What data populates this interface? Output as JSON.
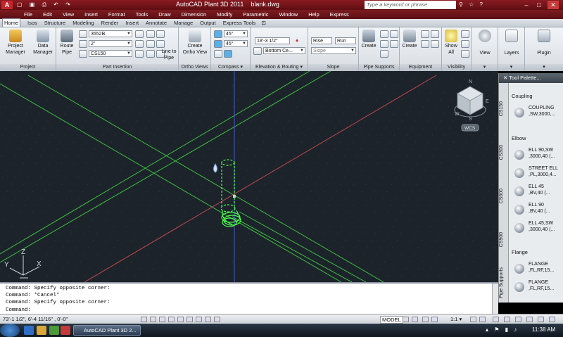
{
  "window": {
    "app_title": "AutoCAD Plant 3D 2011",
    "file_name": "blank.dwg",
    "search_placeholder": "Type a keyword or phrase",
    "min_label": "–",
    "max_label": "□",
    "close_label": "✕"
  },
  "menu": [
    "File",
    "Edit",
    "View",
    "Insert",
    "Format",
    "Tools",
    "Draw",
    "Dimension",
    "Modify",
    "Parametric",
    "Window",
    "Help",
    "Express"
  ],
  "tabs": [
    "Home",
    "Isos",
    "Structure",
    "Modeling",
    "Render",
    "Insert",
    "Annotate",
    "Manage",
    "Output",
    "Express Tools"
  ],
  "active_tab": "Home",
  "ribbon": {
    "project": {
      "label": "Project",
      "manager": "Project\nManager",
      "data_manager": "Data\nManager"
    },
    "part_insertion": {
      "label": "Part Insertion",
      "route_pipe": "Route\nPipe",
      "spec": "3552B",
      "size": "2\"",
      "class": "CS150"
    },
    "ortho_views": {
      "label": "Ortho Views",
      "create": "Create\nOrtho View"
    },
    "compass": {
      "label": "Compass",
      "angle1": "45°",
      "angle2": "45°"
    },
    "elevation": {
      "label": "Elevation & Routing",
      "elevation_value": "18'-3 1/2\"",
      "justify": "Bottom Ce..."
    },
    "slope": {
      "label": "Slope",
      "rise": "Rise",
      "run": "Run",
      "slope": "Slope"
    },
    "pipe_supports": {
      "label": "Pipe Supports",
      "create": "Create"
    },
    "equipment": {
      "label": "Equipment",
      "create": "Create"
    },
    "visibility": {
      "label": "Visibility",
      "show_all": "Show\nAll"
    },
    "view": {
      "label": "View"
    },
    "layers": {
      "label": "Layers"
    },
    "plugin": {
      "label": "Plugin"
    }
  },
  "viewcube": {
    "wcs": "WCS",
    "n": "N",
    "s": "S",
    "w": "W",
    "e": "E"
  },
  "ucs": {
    "x": "X",
    "y": "Y",
    "z": "Z"
  },
  "palette": {
    "title": "Tool Palette...",
    "vertical_tabs": [
      "CS150",
      "CS300",
      "CS600",
      "CS900",
      "Pipe Supports"
    ],
    "categories": [
      "Coupling",
      "Elbow",
      "Flange"
    ],
    "coupling": [
      {
        "line1": "COUPLING",
        "line2": ",SW,3000,..."
      }
    ],
    "elbow": [
      {
        "line1": "ELL 90,SW",
        "line2": ",3000,40 (..."
      },
      {
        "line1": "STREET ELL",
        "line2": ",PL,3000,4..."
      },
      {
        "line1": "ELL 45",
        "line2": ",BV,40 (..."
      },
      {
        "line1": "ELL 90",
        "line2": ",BV,40 (..."
      },
      {
        "line1": "ELL 45,SW",
        "line2": ",3000,40 (..."
      }
    ],
    "flange": [
      {
        "line1": "FLANGE",
        "line2": ",FL,RF,15..."
      },
      {
        "line1": "FLANGE",
        "line2": ",FL,RF,15..."
      }
    ]
  },
  "command_lines": [
    "Command: Specify opposite corner:",
    "Command: *Cancel*",
    "Command: Specify opposite corner:",
    "Command:"
  ],
  "status": {
    "coords": "73'-1 1/2\",  6'-4 11/16\" , 0'-0\"",
    "model": "MODEL",
    "scale": "1:1"
  },
  "taskbar": {
    "task_label": "AutoCAD Plant 3D 2...",
    "clock": "11:38 AM"
  },
  "colors": {
    "title_bar": "#8a1c22",
    "viewport_bg": "#1c232b",
    "grid_green": "#3fbf3f",
    "axis_red": "#c04a4a",
    "axis_blue": "#4a5ad0",
    "pipe_green": "#4cff4c"
  }
}
